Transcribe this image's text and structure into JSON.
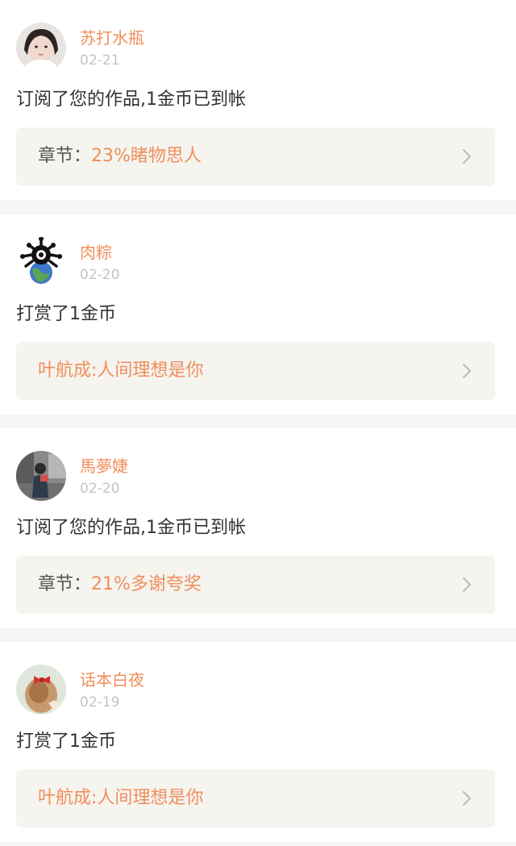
{
  "notifications": [
    {
      "username": "苏打水瓶",
      "date": "02-21",
      "message": "订阅了您的作品,1金币已到帐",
      "link_prefix": "章节：",
      "link_title": "23%睹物思人",
      "avatar_icon": "portrait-avatar-girl"
    },
    {
      "username": "肉粽",
      "date": "02-20",
      "message": "打赏了1金币",
      "link_prefix": "",
      "link_title": "叶航成:人间理想是你",
      "avatar_icon": "cartoon-globe-avatar"
    },
    {
      "username": "馬夢婕",
      "date": "02-20",
      "message": "订阅了您的作品,1金币已到帐",
      "link_prefix": "章节：",
      "link_title": "21%多谢夸奖",
      "avatar_icon": "street-photo-avatar"
    },
    {
      "username": "话本白夜",
      "date": "02-19",
      "message": "打赏了1金币",
      "link_prefix": "",
      "link_title": "叶航成:人间理想是你",
      "avatar_icon": "hair-bow-avatar"
    }
  ],
  "colors": {
    "accent": "#f08e5c",
    "link_box_bg": "#f5f4ef",
    "page_bg": "#f5f5f5",
    "date_text": "#c3c3c3",
    "body_text": "#333333"
  }
}
